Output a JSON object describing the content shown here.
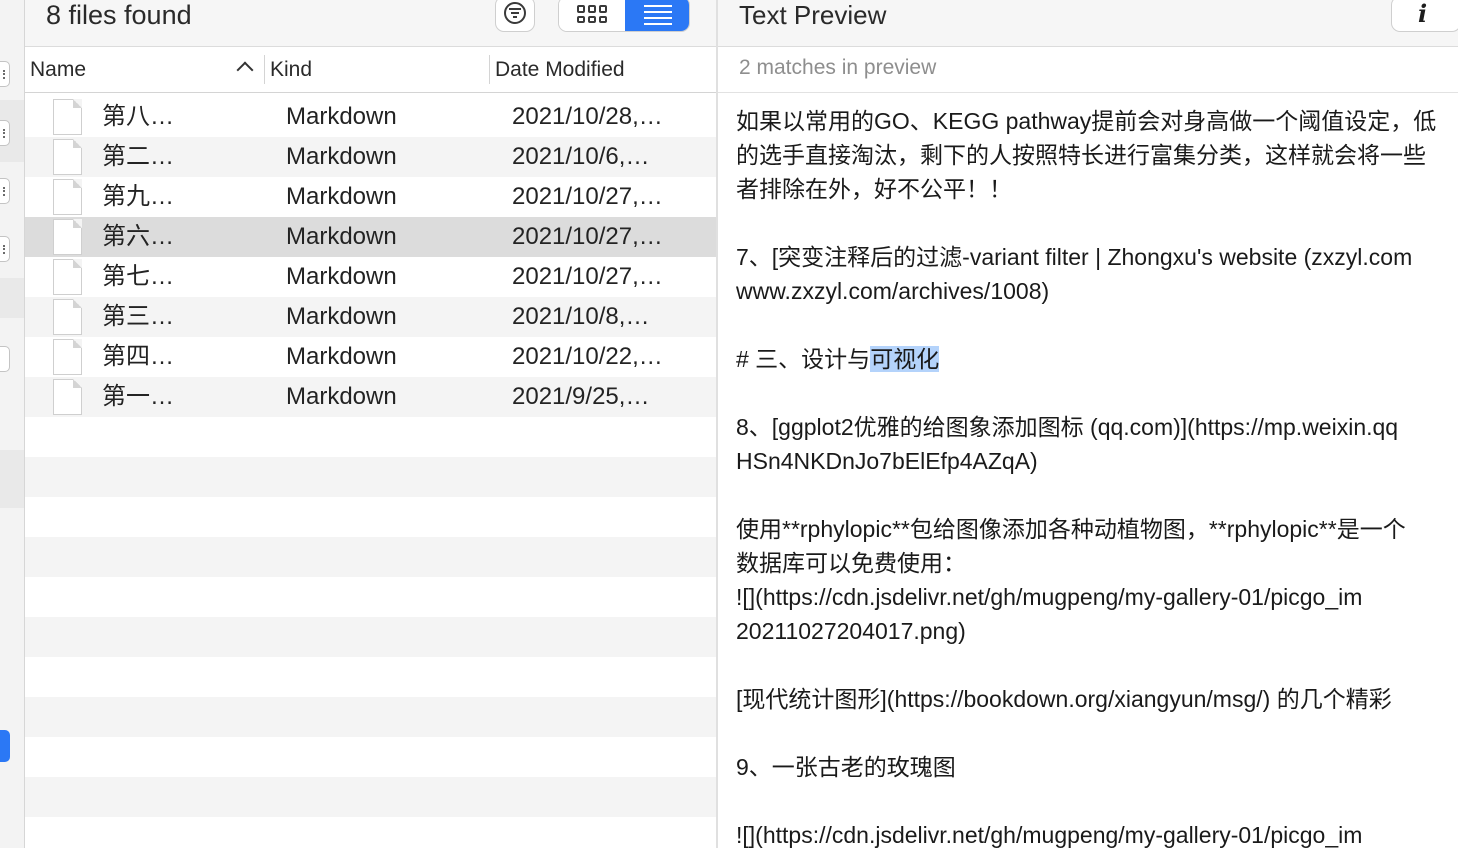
{
  "results": {
    "title": "8 files found",
    "columns": {
      "name": "Name",
      "kind": "Kind",
      "date": "Date Modified"
    },
    "files": [
      {
        "name": "第八…",
        "kind": "Markdown",
        "date": "2021/10/28,…"
      },
      {
        "name": "第二…",
        "kind": "Markdown",
        "date": "2021/10/6,…"
      },
      {
        "name": "第九…",
        "kind": "Markdown",
        "date": "2021/10/27,…"
      },
      {
        "name": "第六…",
        "kind": "Markdown",
        "date": "2021/10/27,…"
      },
      {
        "name": "第七…",
        "kind": "Markdown",
        "date": "2021/10/27,…"
      },
      {
        "name": "第三…",
        "kind": "Markdown",
        "date": "2021/10/8,…"
      },
      {
        "name": "第四…",
        "kind": "Markdown",
        "date": "2021/10/22,…"
      },
      {
        "name": "第一…",
        "kind": "Markdown",
        "date": "2021/9/25,…"
      }
    ],
    "selected_index": 3
  },
  "toolbar": {
    "filter_icon": "filter-circle-icon",
    "grid_view_icon": "icon-grid-view-icon",
    "list_view_icon": "list-view-icon",
    "active_view": "list"
  },
  "preview": {
    "title": "Text Preview",
    "info_icon": "info-icon",
    "info_label": "i",
    "match_count": "2 matches in preview",
    "highlight_color": "#b4d3fb",
    "lines": {
      "l1": "如果以常用的GO、KEGG pathway提前会对身高做一个阈值设定，低",
      "l2": "的选手直接淘汰，剩下的人按照特长进行富集分类，这样就会将一些",
      "l3": "者排除在外，好不公平！！",
      "l4": "7、[突变注释后的过滤-variant filter | Zhongxu's website (zxzyl.com",
      "l5": "www.zxzyl.com/archives/1008)",
      "l6_pre": "# 三、设计与",
      "l6_hl": "可视化",
      "l7": "8、[ggplot2优雅的给图象添加图标 (qq.com)](https://mp.weixin.qq",
      "l8": "HSn4NKDnJo7bElEfp4AZqA)",
      "l9": "使用**rphylopic**包给图像添加各种动植物图，**rphylopic**是一个",
      "l10": "数据库可以免费使用：",
      "l11": "![](https://cdn.jsdelivr.net/gh/mugpeng/my-gallery-01/picgo_im",
      "l12": "20211027204017.png)",
      "l13": "[现代统计图形](https://bookdown.org/xiangyun/msg/) 的几个精彩",
      "l14": "9、一张古老的玫瑰图",
      "l15": "![](https://cdn.jsdelivr.net/gh/mugpeng/my-gallery-01/picgo_im"
    }
  },
  "colors": {
    "accent": "#2b78f5",
    "row_alt": "#f4f4f4",
    "row_selected": "#dcdcdc"
  }
}
